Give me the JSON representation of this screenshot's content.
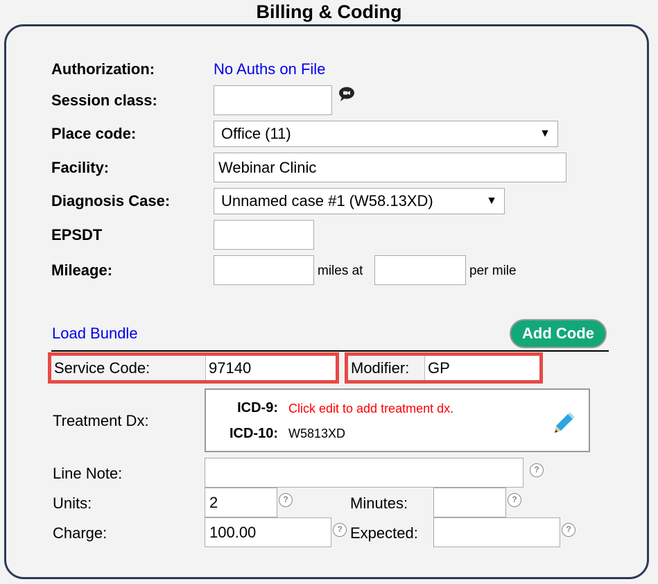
{
  "title": "Billing & Coding",
  "authorization": {
    "label": "Authorization:",
    "value": "No Auths on File"
  },
  "session_class": {
    "label": "Session class:",
    "value": "",
    "icon": "video-chat-icon"
  },
  "place_code": {
    "label": "Place code:",
    "selected": "Office (11)"
  },
  "facility": {
    "label": "Facility:",
    "value": "Webinar Clinic"
  },
  "diagnosis_case": {
    "label": "Diagnosis Case:",
    "selected": "Unnamed case #1 (W58.13XD)"
  },
  "epsdt": {
    "label": "EPSDT",
    "value": ""
  },
  "mileage": {
    "label": "Mileage:",
    "miles_value": "",
    "miles_at": "miles at",
    "rate_value": "",
    "per_mile": "per mile"
  },
  "load_bundle": "Load Bundle",
  "add_code": "Add Code",
  "service_code": {
    "label": "Service Code:",
    "value": "97140"
  },
  "modifier": {
    "label": "Modifier:",
    "value": "GP"
  },
  "treatment_dx": {
    "label": "Treatment Dx:",
    "icd9_label": "ICD-9:",
    "icd9_value": "Click edit to add treatment dx.",
    "icd10_label": "ICD-10:",
    "icd10_value": "W5813XD"
  },
  "line_note": {
    "label": "Line Note:",
    "value": ""
  },
  "units": {
    "label": "Units:",
    "value": "2"
  },
  "minutes": {
    "label": "Minutes:",
    "value": ""
  },
  "charge": {
    "label": "Charge:",
    "value": "100.00"
  },
  "expected": {
    "label": "Expected:",
    "value": ""
  },
  "help_glyph": "?",
  "select_arrow": "▼",
  "colors": {
    "link": "#0000ee",
    "accent_green": "#13a878",
    "highlight_red": "#e54b45",
    "error_red": "#ff0000",
    "panel_border": "#2c3a55"
  }
}
